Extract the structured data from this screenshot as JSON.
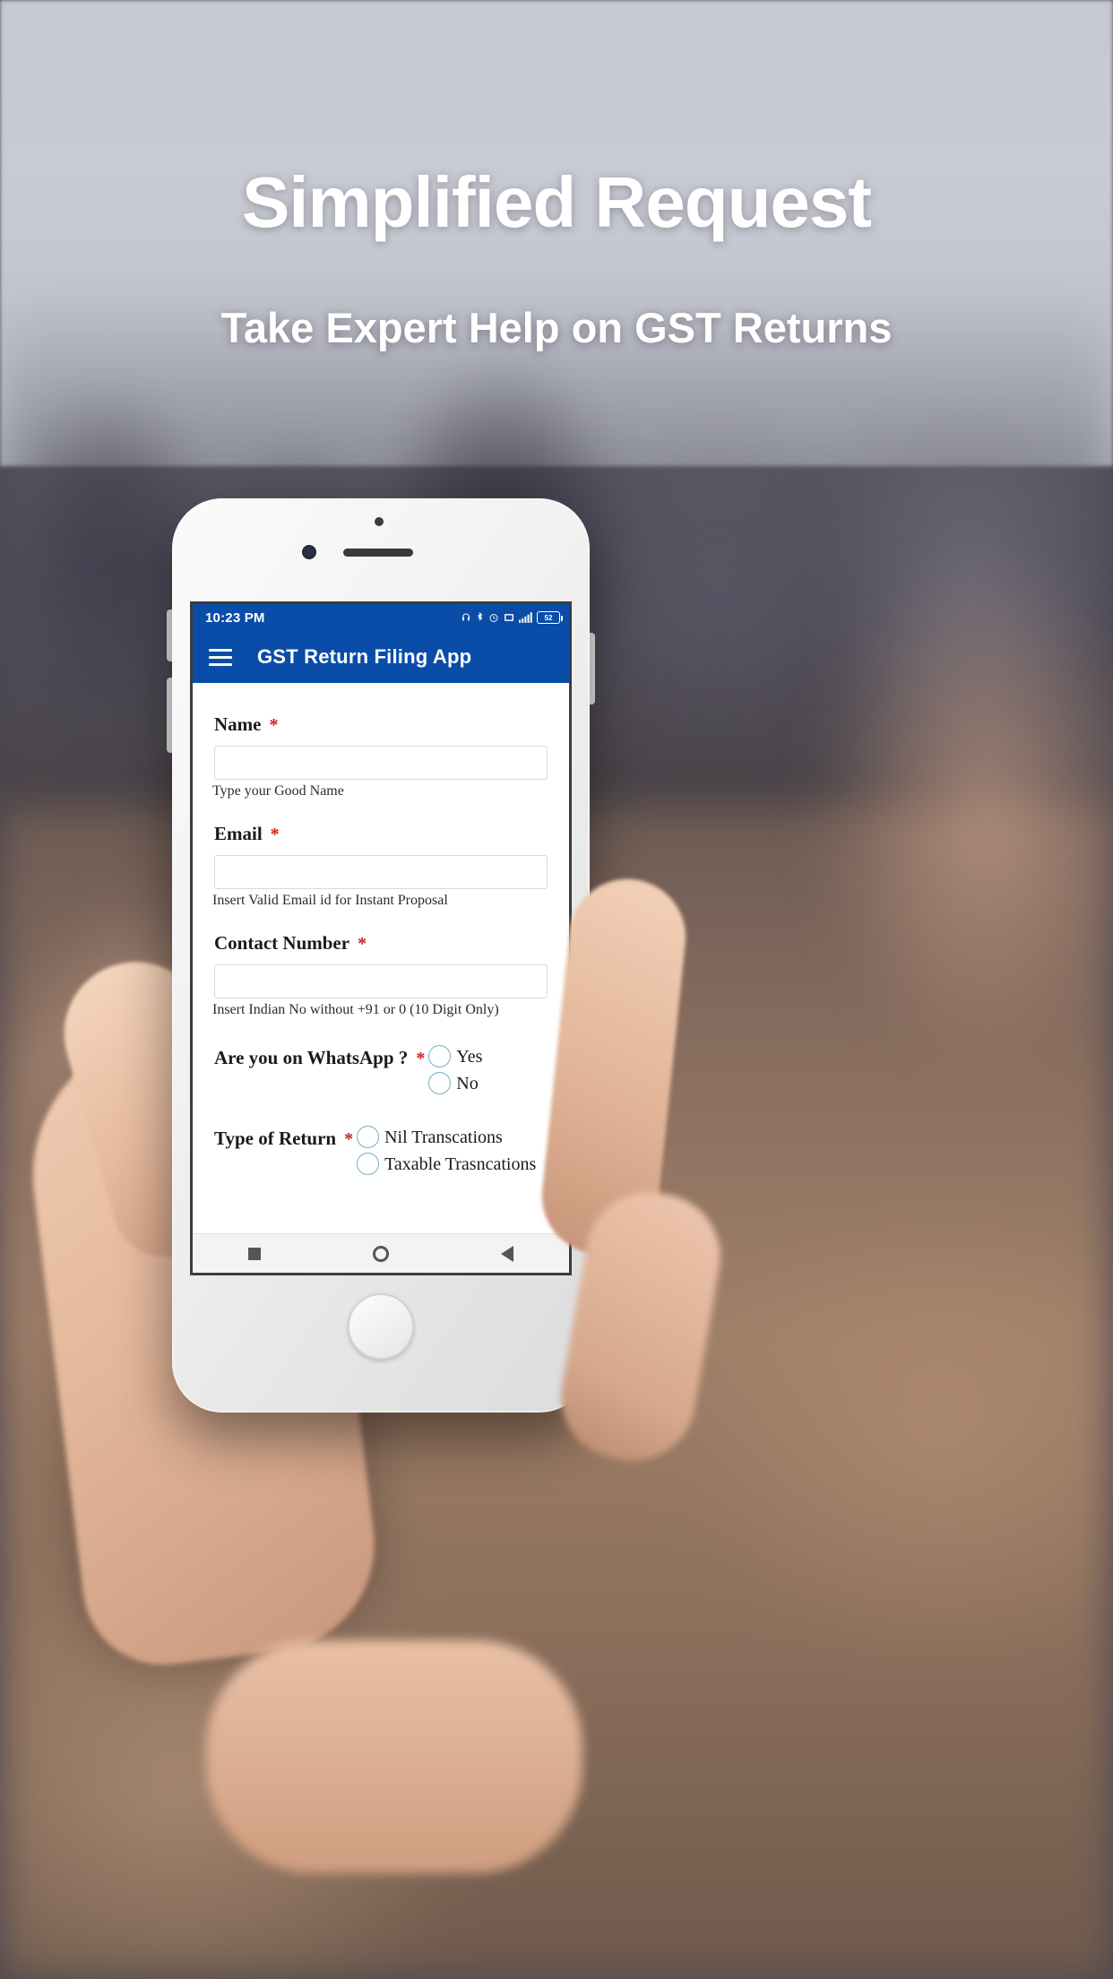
{
  "hero": {
    "title": "Simplified Request",
    "subtitle": "Take Expert Help on GST Returns"
  },
  "colors": {
    "app_blue": "#0A4DA8",
    "required_red": "#cc2222",
    "radio_outline": "#77aec4"
  },
  "phone": {
    "statusbar": {
      "time": "10:23 PM",
      "battery_level": "52",
      "icons": [
        "headset-icon",
        "bluetooth-icon",
        "alarm-icon",
        "screenshot-icon",
        "signal-icon",
        "battery-icon"
      ]
    },
    "appbar": {
      "menu_icon": "hamburger-menu-icon",
      "title": "GST Return Filing App"
    },
    "form": {
      "fields": [
        {
          "label": "Name",
          "required": "*",
          "value": "",
          "placeholder": "",
          "hint": "Type your Good Name"
        },
        {
          "label": "Email",
          "required": "*",
          "value": "",
          "placeholder": "",
          "hint": "Insert Valid Email id for Instant Proposal"
        },
        {
          "label": "Contact Number",
          "required": "*",
          "value": "",
          "placeholder": "",
          "hint": "Insert Indian No without +91 or 0 (10 Digit Only)"
        }
      ],
      "radio_groups": [
        {
          "label": "Are you on WhatsApp ?",
          "required": "*",
          "options": [
            {
              "text": "Yes",
              "selected": false
            },
            {
              "text": "No",
              "selected": false
            }
          ]
        },
        {
          "label": "Type of Return",
          "required": "*",
          "options": [
            {
              "text": "Nil Transcations",
              "selected": false
            },
            {
              "text": "Taxable Trasncations",
              "selected": false
            }
          ]
        }
      ]
    },
    "navbar": {
      "buttons": [
        "recents-square-icon",
        "home-circle-icon",
        "back-triangle-icon"
      ]
    }
  }
}
